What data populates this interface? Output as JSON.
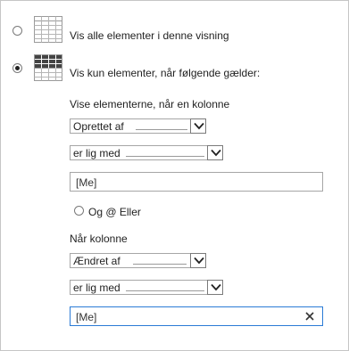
{
  "option_all": {
    "label": "Vis alle elementer i denne visning",
    "selected": false,
    "icon": "grid-view-icon"
  },
  "option_filtered": {
    "label": "Vis kun elementer, når følgende gælder:",
    "selected": true,
    "icon": "filtered-grid-view-icon"
  },
  "condition1": {
    "heading": "Vise elementerne, når en kolonne",
    "column_value": "Oprettet af",
    "operator_value": "er lig med",
    "value": "[Me]"
  },
  "logic": {
    "label": "Og @ Eller"
  },
  "condition2": {
    "heading": "Når kolonne",
    "column_value": "Ændret af",
    "operator_value": "er lig med",
    "value": "[Me]",
    "clear_icon": "close-icon"
  }
}
